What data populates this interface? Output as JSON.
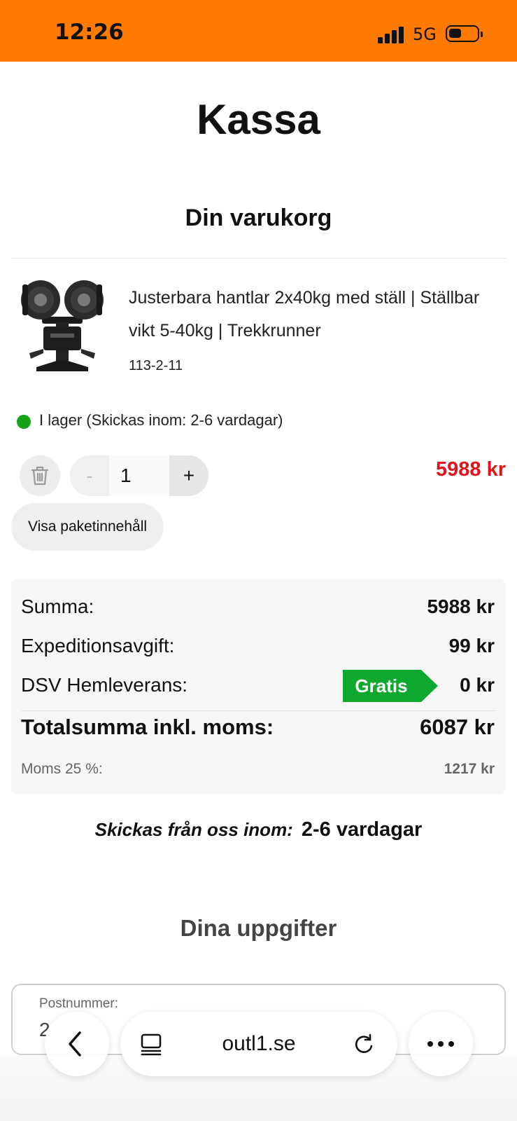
{
  "status_bar": {
    "time": "12:26",
    "network": "5G"
  },
  "page": {
    "title": "Kassa"
  },
  "cart": {
    "heading": "Din varukorg",
    "item": {
      "name": "Justerbara hantlar 2x40kg med ställ | Ställbar vikt 5-40kg | Trekkrunner",
      "sku": "113-2-11",
      "stock_text": "I lager (Skickas inom: 2-6 vardagar)",
      "quantity": "1",
      "minus_label": "-",
      "plus_label": "+",
      "price": "5988 kr"
    },
    "package_button": "Visa paketinnehåll"
  },
  "summary": {
    "sum_label": "Summa:",
    "sum_value": "5988 kr",
    "fee_label": "Expeditionsavgift:",
    "fee_value": "99 kr",
    "delivery_label": "DSV Hemleverans:",
    "delivery_badge": "Gratis",
    "delivery_value": "0 kr",
    "total_label": "Totalsumma inkl. moms:",
    "total_value": "6087 kr",
    "vat_label": "Moms 25 %:",
    "vat_value": "1217 kr"
  },
  "shipping": {
    "prefix": "Skickas från oss inom:",
    "days": "2-6 vardagar"
  },
  "details": {
    "heading": "Dina uppgifter",
    "postal_label": "Postnummer:",
    "postal_value": "2"
  },
  "browser": {
    "url": "outl1.se"
  },
  "colors": {
    "brand_orange": "#FF7A00",
    "price_red": "#E0141E",
    "stock_green": "#16A016",
    "badge_green": "#0FA82E"
  },
  "icons": [
    "signal-icon",
    "battery-icon",
    "trash-icon",
    "back-icon",
    "tabs-icon",
    "reload-icon",
    "more-icon",
    "stock-dot-icon"
  ]
}
